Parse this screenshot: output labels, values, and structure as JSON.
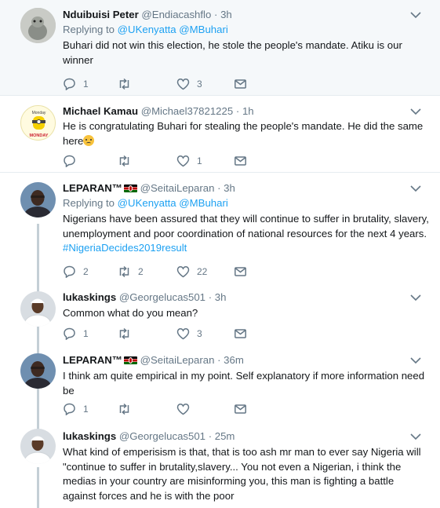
{
  "tweets": [
    {
      "name": "Nduibuisi Peter",
      "handle": "@Endiacashflo",
      "time": "3h",
      "replying_prefix": "Replying to",
      "replying_to": [
        "@UKenyatta",
        "@MBuhari"
      ],
      "text": "Buhari did not win this election, he stole the people's mandate. Atiku is our winner",
      "replies": "1",
      "retweets": "",
      "likes": "3"
    },
    {
      "name": "Michael Kamau",
      "handle": "@Michael37821225",
      "time": "1h",
      "avatar_text": [
        "Monday",
        "MONDAY"
      ],
      "text": "He is congratulating Buhari for stealing the people's mandate. He did the same here",
      "replies": "",
      "retweets": "",
      "likes": "1"
    },
    {
      "name": "LEPARAN™",
      "handle": "@SeitaiLeparan",
      "time": "3h",
      "replying_prefix": "Replying to",
      "replying_to": [
        "@UKenyatta",
        "@MBuhari"
      ],
      "text": "Nigerians have been assured that they will continue to suffer in brutality, slavery, unemployment and poor coordination of national resources for the next 4 years.",
      "hashtag": "#NigeriaDecides2019result",
      "replies": "2",
      "retweets": "2",
      "likes": "22"
    },
    {
      "name": "lukaskings",
      "handle": "@Georgelucas501",
      "time": "3h",
      "text": "Common what do you mean?",
      "replies": "1",
      "retweets": "",
      "likes": "3"
    },
    {
      "name": "LEPARAN™",
      "handle": "@SeitaiLeparan",
      "time": "36m",
      "text": "I think am quite empirical in my point. Self explanatory if more information need be",
      "replies": "1",
      "retweets": "",
      "likes": ""
    },
    {
      "name": "lukaskings",
      "handle": "@Georgelucas501",
      "time": "25m",
      "text": "What kind of emperisism is that, that is too ash mr man to ever say Nigeria will \"continue to suffer in brutality,slavery... You not even a Nigerian, i think the medias in your country are misinforming you, this man is fighting a battle against forces and he is with the poor"
    }
  ],
  "colors": {
    "accent": "#1da1f2",
    "muted": "#657786",
    "thread_line": "#c4cfd6",
    "highlight_bg": "#f5f8fa"
  },
  "icons": {
    "reply": "reply-icon",
    "retweet": "retweet-icon",
    "like": "heart-icon",
    "dm": "envelope-icon",
    "menu": "chevron-down-icon"
  }
}
